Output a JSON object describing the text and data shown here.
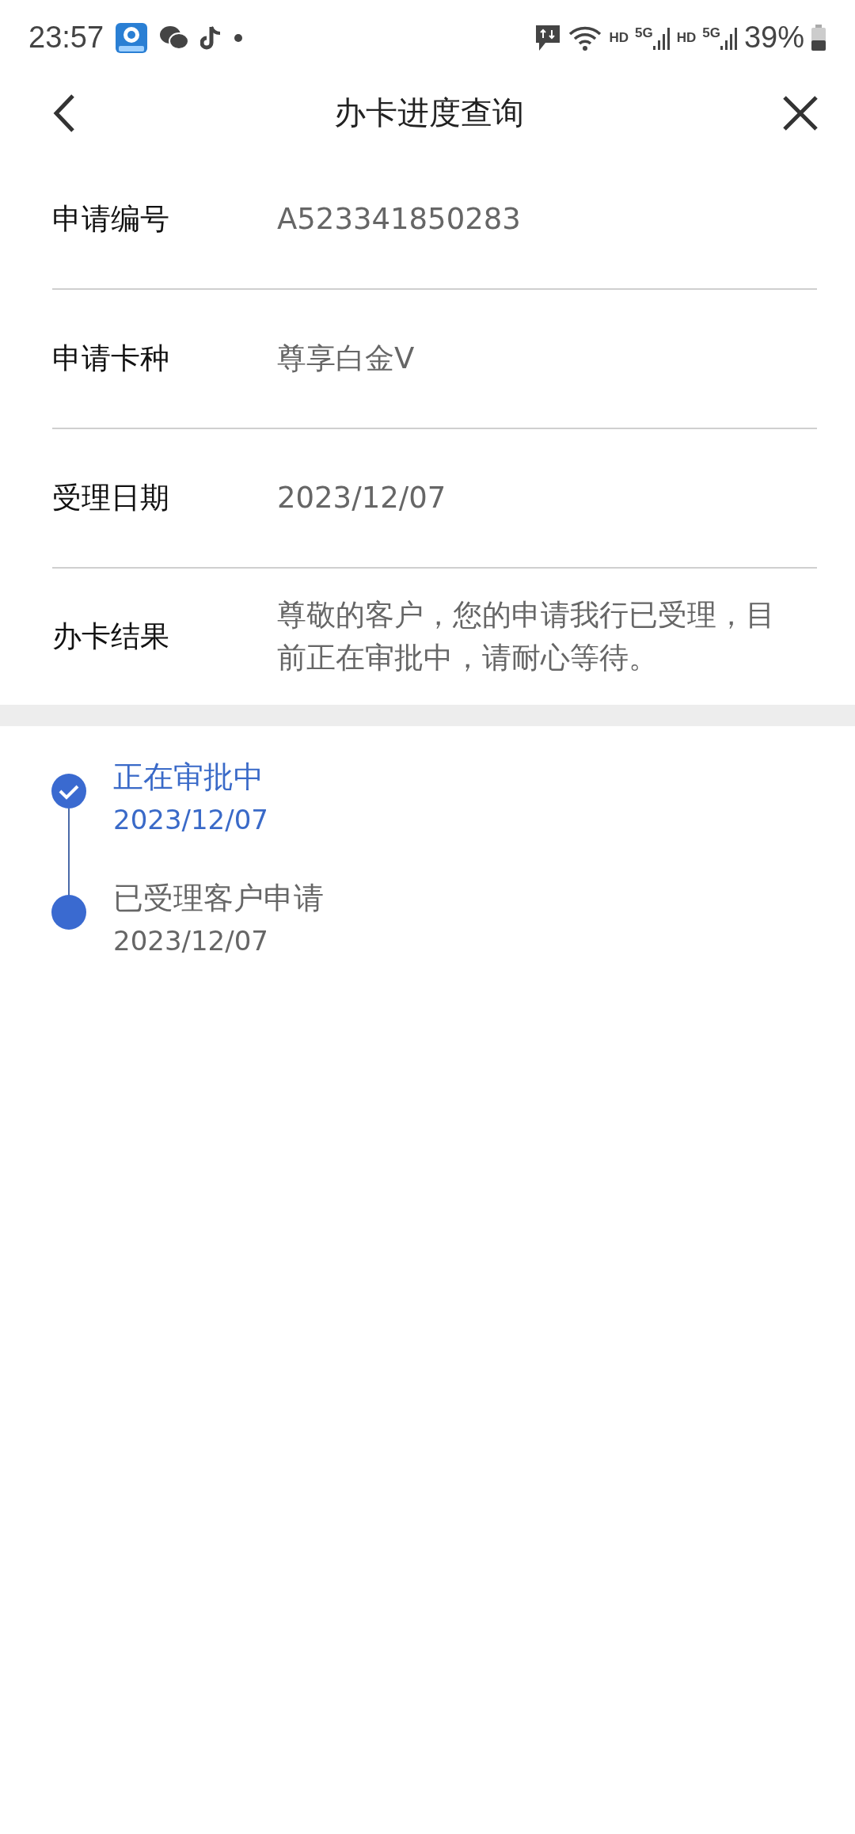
{
  "status_bar": {
    "time": "23:57",
    "network_labels": [
      "HD",
      "5G",
      "HD",
      "5G"
    ],
    "battery": "39%"
  },
  "header": {
    "title": "办卡进度查询"
  },
  "details": [
    {
      "label": "申请编号",
      "value": "A523341850283"
    },
    {
      "label": "申请卡种",
      "value": "尊享白金V"
    },
    {
      "label": "受理日期",
      "value": "2023/12/07"
    },
    {
      "label": "办卡结果",
      "value": "尊敬的客户，您的申请我行已受理，目前正在审批中，请耐心等待。"
    }
  ],
  "timeline": [
    {
      "title": "正在审批中",
      "date": "2023/12/07",
      "current": true
    },
    {
      "title": "已受理客户申请",
      "date": "2023/12/07",
      "current": false
    }
  ]
}
